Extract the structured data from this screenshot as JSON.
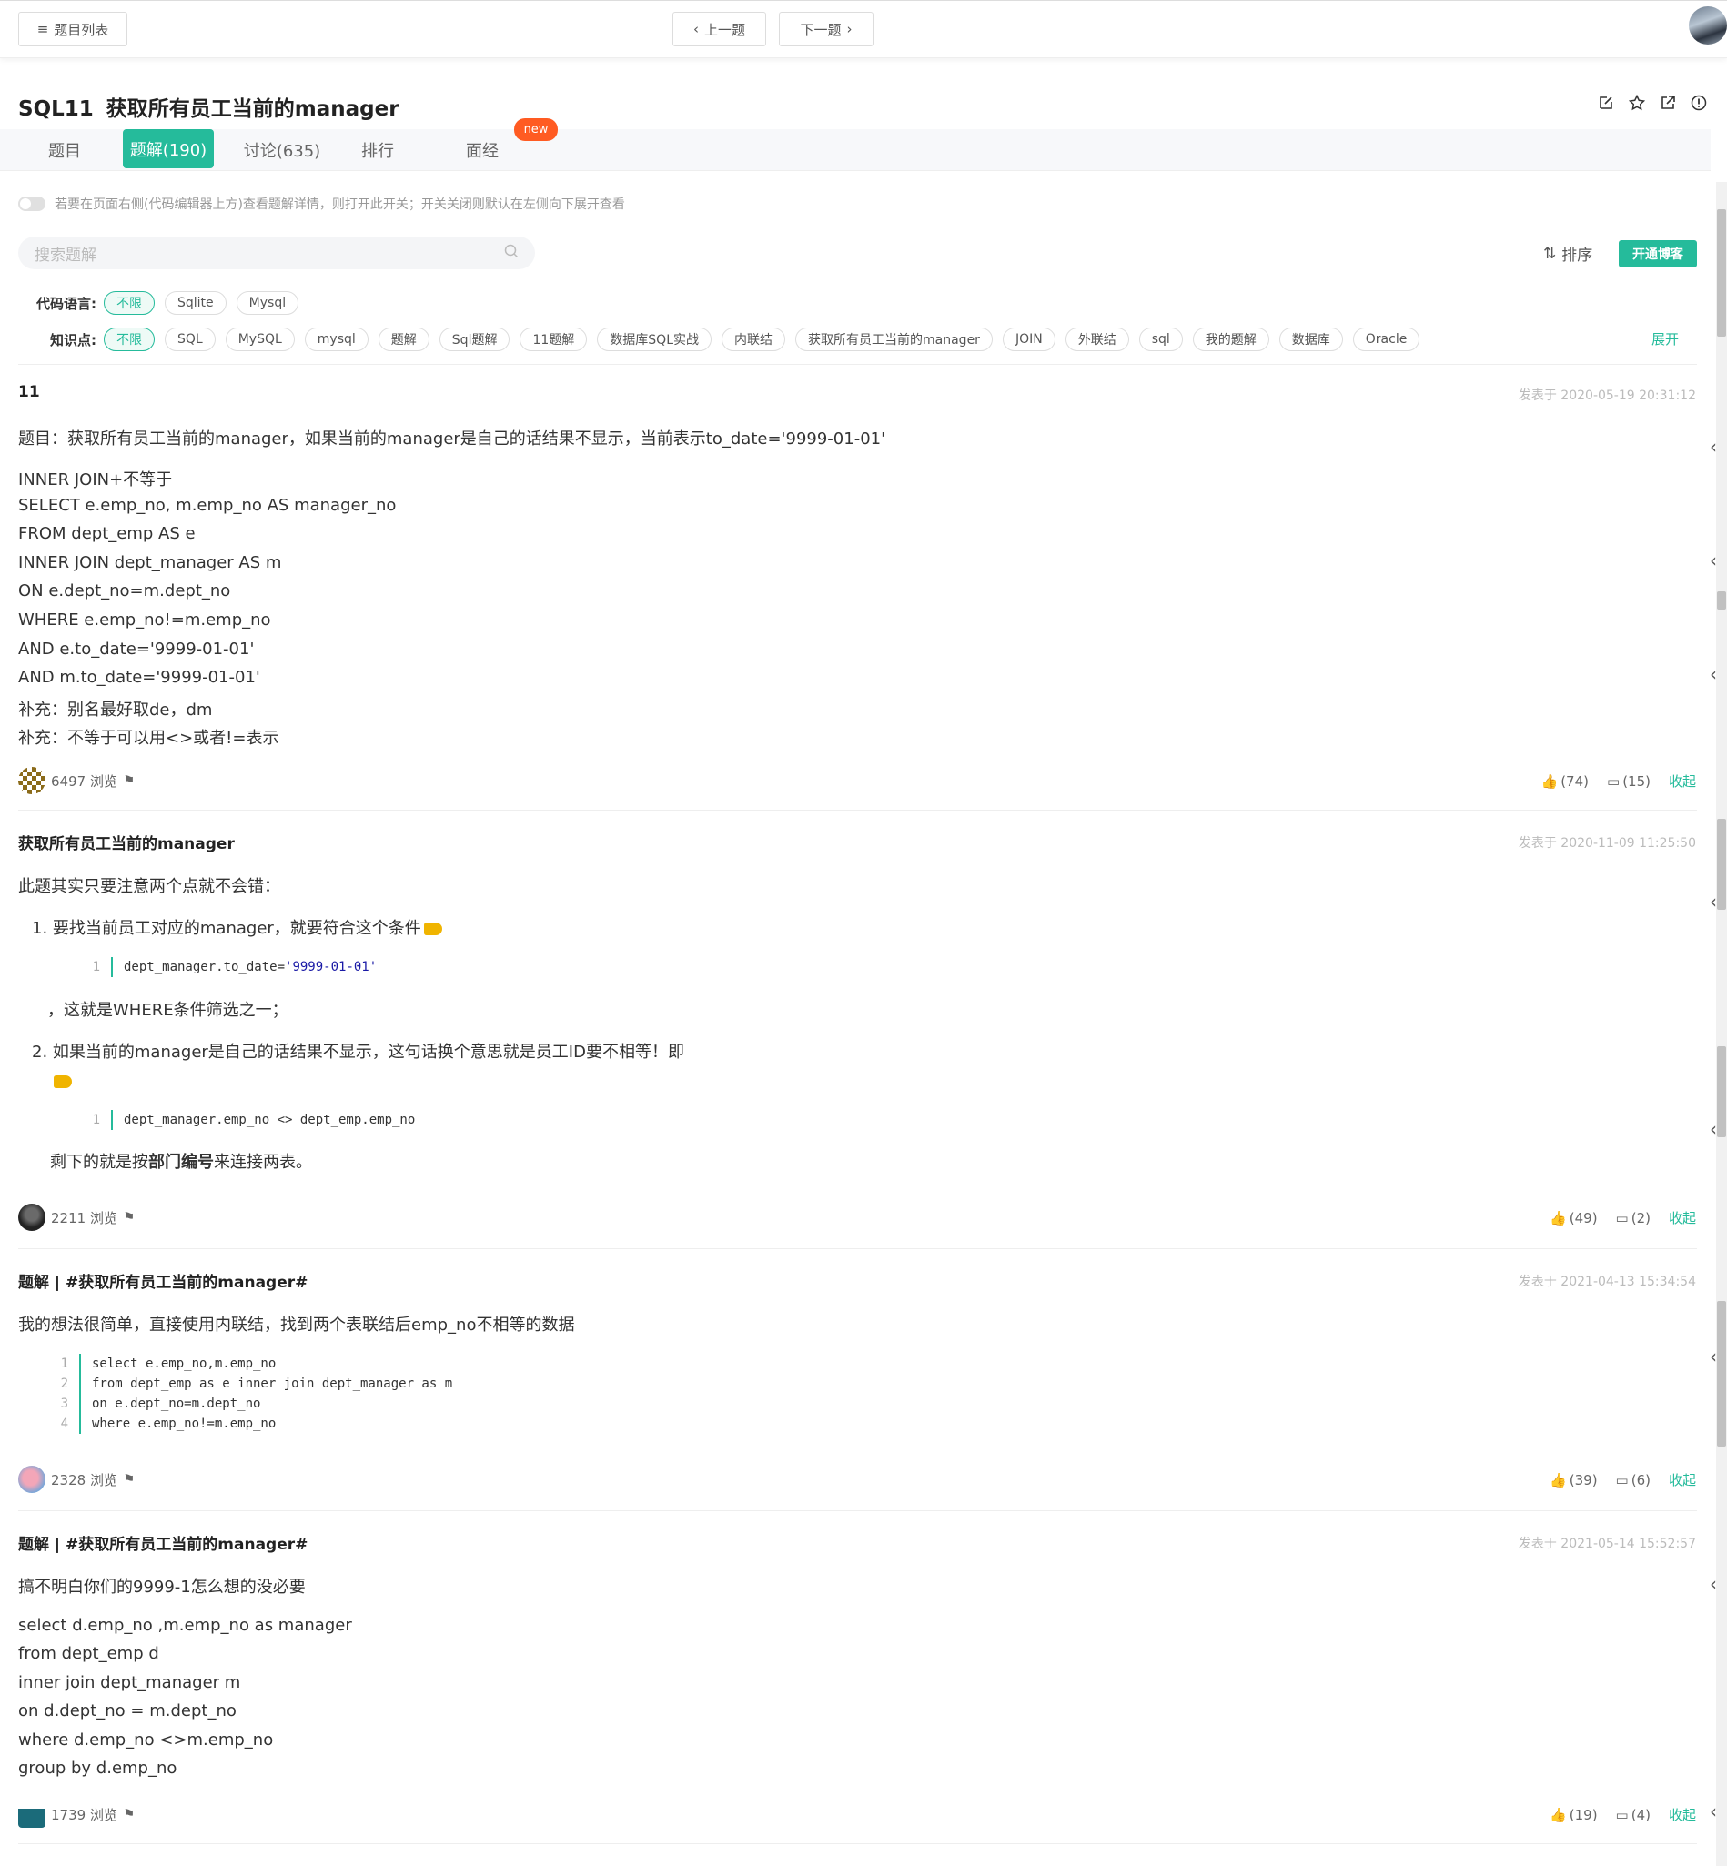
{
  "topbar": {
    "list_label": "题目列表",
    "prev_label": "上一题",
    "next_label": "下一题"
  },
  "problem": {
    "number": "SQL11",
    "title": "获取所有员工当前的manager"
  },
  "tabs": [
    {
      "label": "题目"
    },
    {
      "label": "题解(190)"
    },
    {
      "label": "讨论(635)"
    },
    {
      "label": "排行"
    },
    {
      "label": "面经"
    }
  ],
  "new_badge": "new",
  "toggle_text": "若要在页面右侧(代码编辑器上方)查看题解详情，则打开此开关；开关关闭则默认在左侧向下展开查看",
  "search": {
    "placeholder": "搜索题解"
  },
  "sort_label": "排序",
  "blog_button": "开通博客",
  "filters": {
    "lang_label": "代码语言:",
    "lang": [
      "不限",
      "Sqlite",
      "Mysql"
    ],
    "topic_label": "知识点:",
    "topics": [
      "不限",
      "SQL",
      "MySQL",
      "mysql",
      "题解",
      "Sql题解",
      "11题解",
      "数据库SQL实战",
      "内联结",
      "获取所有员工当前的manager",
      "JOIN",
      "外联结",
      "sql",
      "我的题解",
      "数据库",
      "Oracle"
    ],
    "expand": "展开"
  },
  "posts": [
    {
      "title": "11",
      "date": "发表于 2020-05-19 20:31:12",
      "lines": [
        "题目：获取所有员工当前的manager，如果当前的manager是自己的话结果不显示，当前表示to_date='9999-01-01'",
        "INNER JOIN+不等于",
        "SELECT e.emp_no, m.emp_no AS manager_no",
        "FROM dept_emp AS e",
        "INNER JOIN dept_manager AS m",
        "ON e.dept_no=m.dept_no",
        "WHERE e.emp_no!=m.emp_no",
        "AND e.to_date='9999-01-01'",
        "AND m.to_date='9999-01-01'",
        "补充：别名最好取de，dm",
        "补充：不等于可以用<>或者!=表示"
      ],
      "views": "6497 浏览",
      "likes": "(74)",
      "comments": "(15)",
      "fold": "收起"
    },
    {
      "title": "获取所有员工当前的manager",
      "date": "发表于 2020-11-09 11:25:50",
      "intro": "此题其实只要注意两个点就不会错：",
      "item1": "1. 要找当前员工对应的manager，就要符合这个条件",
      "code1_ln": "1",
      "code1_a": "dept_manager.to_date=",
      "code1_b": "'9999-01-01'",
      "after1": "，这就是WHERE条件筛选之一；",
      "item2": "2. 如果当前的manager是自己的话结果不显示，这句话换个意思就是员工ID要不相等！即",
      "code2_ln": "1",
      "code2": "dept_manager.emp_no <> dept_emp.emp_no",
      "rest_a": "剩下的就是按",
      "rest_b": "部门编号",
      "rest_c": "来连接两表。",
      "views": "2211 浏览",
      "likes": "(49)",
      "comments": "(2)",
      "fold": "收起"
    },
    {
      "title": "题解 | #获取所有员工当前的manager#",
      "date": "发表于 2021-04-13 15:34:54",
      "intro": "我的想法很简单，直接使用内联结，找到两个表联结后emp_no不相等的数据",
      "code": [
        {
          "ln": "1",
          "text": "select e.emp_no,m.emp_no"
        },
        {
          "ln": "2",
          "text": "from dept_emp as e inner join dept_manager as m"
        },
        {
          "ln": "3",
          "text": "on e.dept_no=m.dept_no"
        },
        {
          "ln": "4",
          "text": "where e.emp_no!=m.emp_no"
        }
      ],
      "views": "2328 浏览",
      "likes": "(39)",
      "comments": "(6)",
      "fold": "收起"
    },
    {
      "title": "题解 | #获取所有员工当前的manager#",
      "date": "发表于 2021-05-14 15:52:57",
      "lines": [
        "搞不明白你们的9999-1怎么想的没必要",
        "select d.emp_no ,m.emp_no as manager",
        "from dept_emp d",
        "inner join dept_manager m",
        "on d.dept_no = m.dept_no",
        "where d.emp_no <>m.emp_no",
        "group by d.emp_no"
      ],
      "views": "1739 浏览",
      "likes": "(19)",
      "comments": "(4)",
      "fold": "收起"
    }
  ],
  "colors": {
    "accent": "#25bb9b",
    "badge": "#ff5b22"
  }
}
